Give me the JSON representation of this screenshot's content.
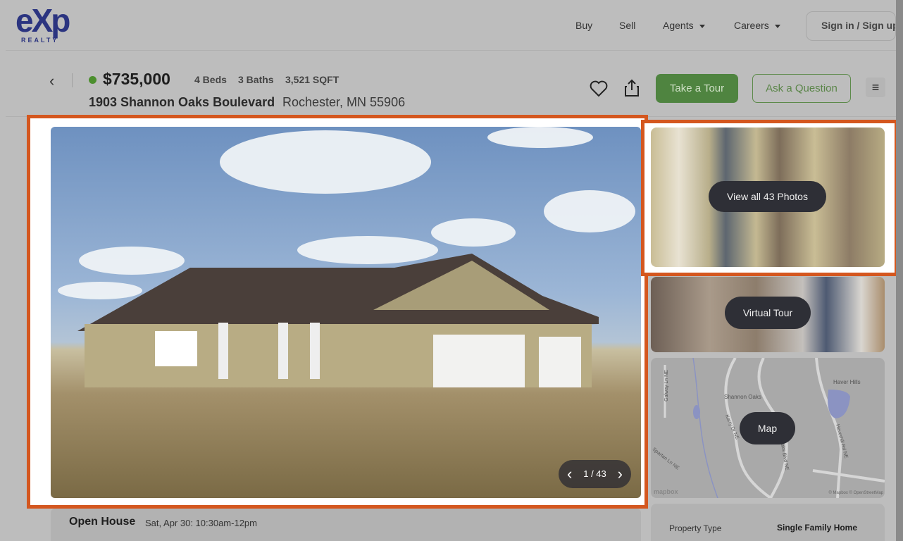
{
  "header": {
    "logo_text": "eXp",
    "logo_sub": "REALTY",
    "nav": [
      "Buy",
      "Sell",
      "Agents",
      "Careers"
    ],
    "signin_label": "Sign in / Sign up"
  },
  "listing": {
    "status_color": "#4c8f2e",
    "price": "$735,000",
    "beds": "4 Beds",
    "baths": "3 Baths",
    "sqft": "3,521 SQFT",
    "street": "1903 Shannon Oaks Boulevard",
    "city": "Rochester, MN 55906",
    "tour_label": "Take a Tour",
    "ask_label": "Ask a Question"
  },
  "gallery": {
    "counter": "1 / 43",
    "current": 1,
    "total": 43,
    "view_all_label": "View all 43 Photos",
    "virtual_tour_label": "Virtual Tour",
    "map_label": "Map"
  },
  "map": {
    "labels": [
      "Haver Hills",
      "Shannon Oaks",
      "Galway Ln NE",
      "Kerry Dr NE",
      "Shannon Oaks Blvd NE",
      "Haverhill Rd NE",
      "Spartan Ln NE"
    ],
    "logo": "mapbox",
    "attribution": "© Mapbox © OpenStreetMap"
  },
  "open_house": {
    "label": "Open House",
    "when": "Sat, Apr 30: 10:30am-12pm"
  },
  "details": {
    "property_type_label": "Property Type",
    "property_type_value": "Single Family Home"
  },
  "colors": {
    "highlight": "#d4571f",
    "accent_green": "#4f8440",
    "brand_blue": "#2b3480"
  }
}
